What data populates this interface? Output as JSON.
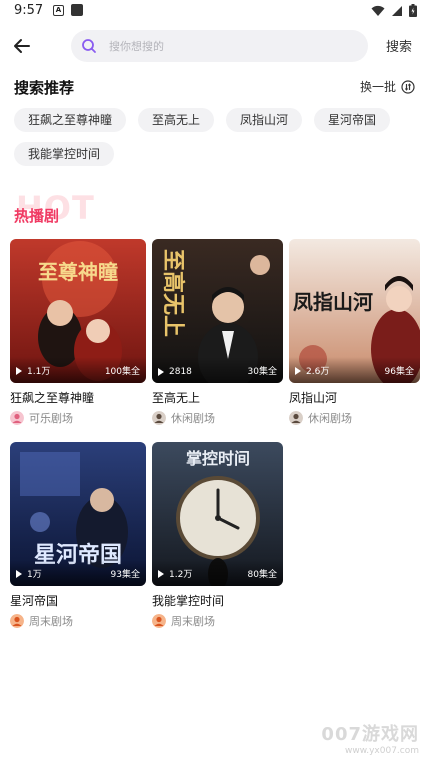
{
  "status": {
    "time": "9:57",
    "notif_letter": "A"
  },
  "search": {
    "placeholder": "搜你想搜的",
    "button_label": "搜索"
  },
  "recommend": {
    "title": "搜索推荐",
    "refresh_label": "换一批",
    "chips": [
      "狂飙之至尊神瞳",
      "至高无上",
      "凤指山河",
      "星河帝国",
      "我能掌控时间"
    ]
  },
  "hot": {
    "bg_text": "HOT",
    "title": "热播剧",
    "accent": "#f03a63"
  },
  "dramas": [
    {
      "title": "狂飙之至尊神瞳",
      "plays": "1.1万",
      "episodes": "100集全",
      "studio": "可乐剧场",
      "poster_text": "至尊神瞳",
      "colors": [
        "#c0392b",
        "#6e1410"
      ]
    },
    {
      "title": "至高无上",
      "plays": "2818",
      "episodes": "30集全",
      "studio": "休闲剧场",
      "poster_text": "至高无上",
      "colors": [
        "#3a2a22",
        "#111111"
      ]
    },
    {
      "title": "凤指山河",
      "plays": "2.6万",
      "episodes": "96集全",
      "studio": "休闲剧场",
      "poster_text": "凤指山河",
      "colors": [
        "#f3e9e1",
        "#c98a6a"
      ]
    },
    {
      "title": "星河帝国",
      "plays": "1万",
      "episodes": "93集全",
      "studio": "周末剧场",
      "poster_text": "星河帝国",
      "colors": [
        "#2b3f7a",
        "#0b1433"
      ]
    },
    {
      "title": "我能掌控时间",
      "plays": "1.2万",
      "episodes": "80集全",
      "studio": "周末剧场",
      "poster_text": "掌控时间",
      "colors": [
        "#3c4a5e",
        "#14181f"
      ]
    }
  ],
  "watermark": {
    "main": "007游戏网",
    "sub": "www.yx007.com"
  }
}
